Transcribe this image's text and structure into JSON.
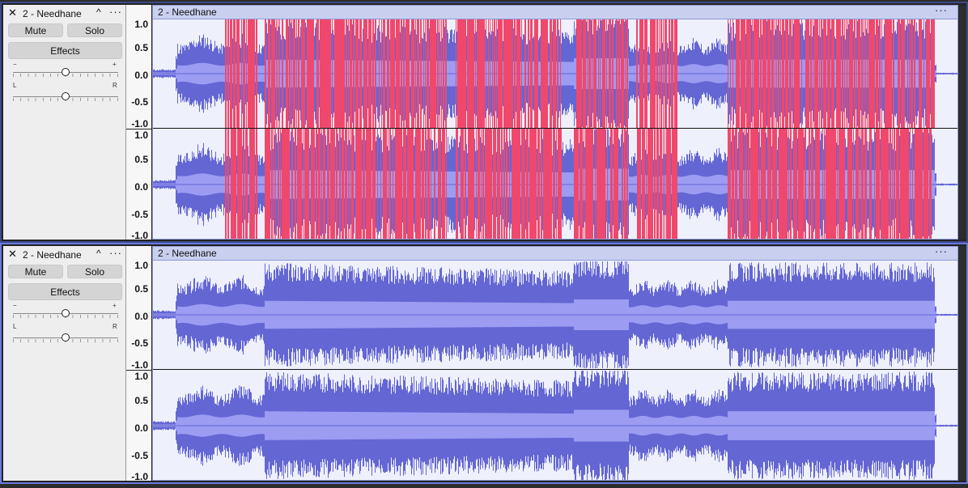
{
  "tracks": [
    {
      "name": "2 - Needhane",
      "clip_title": "2 - Needhane",
      "mute_label": "Mute",
      "solo_label": "Solo",
      "effects_label": "Effects",
      "gain_minus": "−",
      "gain_plus": "+",
      "pan_left": "L",
      "pan_right": "R",
      "close_glyph": "✕",
      "collapse_glyph": "^",
      "menu_glyph": "···",
      "clipping_shown": true
    },
    {
      "name": "2 - Needhane",
      "clip_title": "2 - Needhane",
      "mute_label": "Mute",
      "solo_label": "Solo",
      "effects_label": "Effects",
      "gain_minus": "−",
      "gain_plus": "+",
      "pan_left": "L",
      "pan_right": "R",
      "close_glyph": "✕",
      "collapse_glyph": "^",
      "menu_glyph": "···",
      "clipping_shown": false
    }
  ],
  "ruler_labels": [
    "1.0",
    "0.5",
    "0.0",
    "-0.5",
    "-1.0"
  ],
  "colors": {
    "waveform": "#6466d4",
    "waveform_rms": "#9b9cf2",
    "clipping": "#f0486c",
    "clip_bg": "#eef0fb"
  }
}
